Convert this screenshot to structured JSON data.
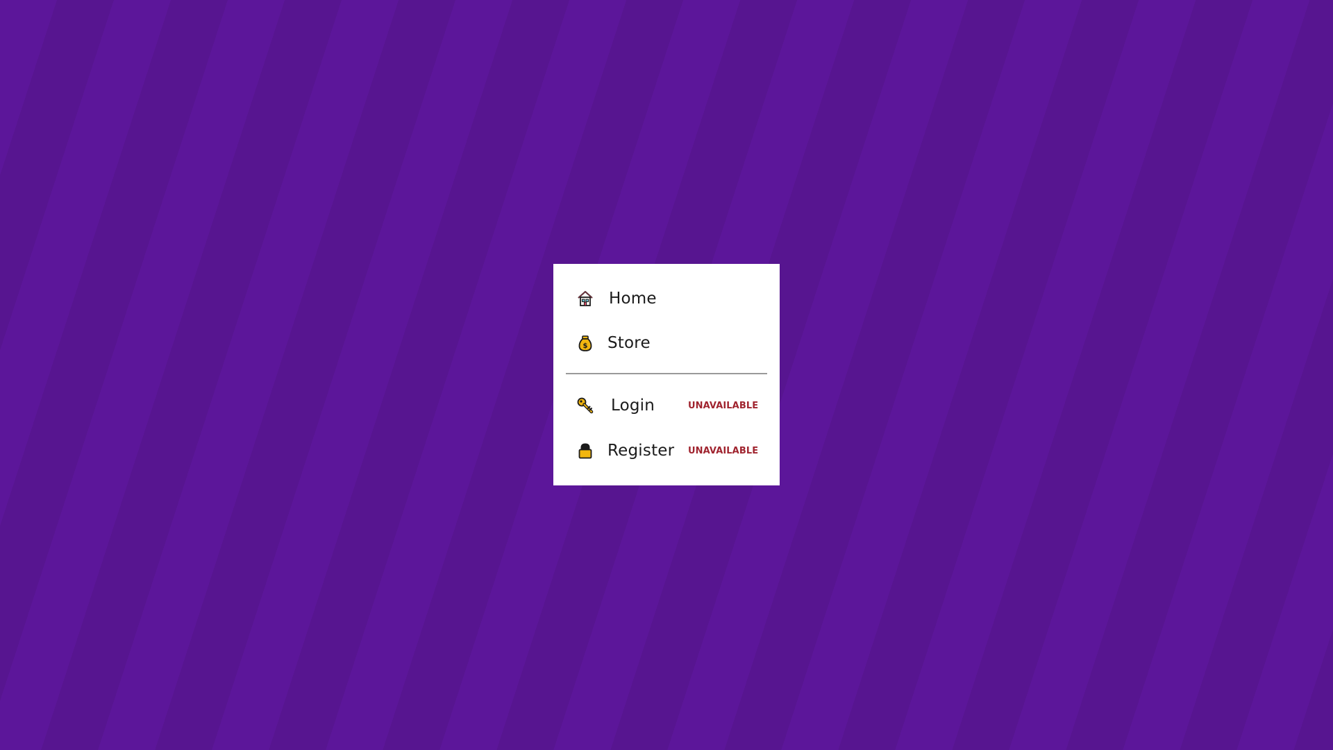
{
  "menu": {
    "items": [
      {
        "label": "Home",
        "icon": "home-icon"
      },
      {
        "label": "Store",
        "icon": "money-bag-icon"
      }
    ],
    "account_items": [
      {
        "label": "Login",
        "icon": "key-icon",
        "badge": "UNAVAILABLE"
      },
      {
        "label": "Register",
        "icon": "lock-icon",
        "badge": "UNAVAILABLE"
      }
    ]
  },
  "colors": {
    "background": "#5a1796",
    "badge": "#a0242f",
    "card": "#ffffff"
  }
}
